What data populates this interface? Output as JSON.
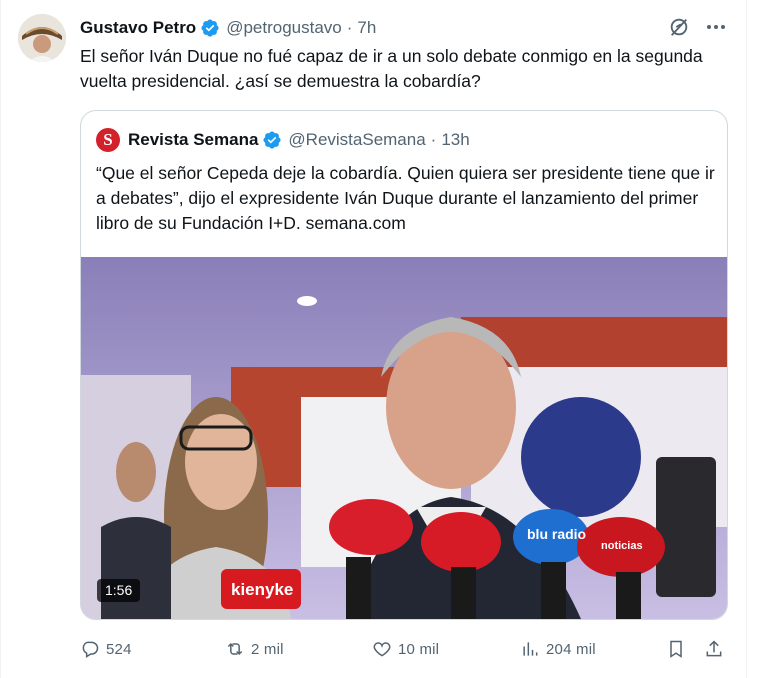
{
  "tweet": {
    "author_name": "Gustavo Petro",
    "handle": "@petrogustavo",
    "separator": "·",
    "time": "7h",
    "text": "El señor Iván Duque no fué capaz de ir a un solo debate conmigo en la segunda vuelta presidencial. ¿así se demuestra la cobardía?"
  },
  "quote": {
    "avatar_letter": "S",
    "author_name": "Revista Semana",
    "handle": "@RevistaSemana",
    "separator": "·",
    "time": "13h",
    "text": "“Que el señor Cepeda deje la cobardía. Quien quiera ser presidente tiene que ir a debates”, dijo el expresidente Iván Duque durante el lanzamiento del primer libro de su Fundación I+D.  semana.com",
    "video": {
      "duration": "1:56",
      "mic_labels": [
        "kienyke",
        "blu radio",
        "noticias"
      ]
    }
  },
  "actions": {
    "replies": "524",
    "reposts": "2 mil",
    "likes": "10 mil",
    "views": "204 mil"
  },
  "icons": {
    "verified": "verified-badge-icon",
    "grok": "grok-icon",
    "more": "more-icon",
    "reply": "reply-icon",
    "repost": "repost-icon",
    "like": "like-icon",
    "views": "views-icon",
    "bookmark": "bookmark-icon",
    "share": "share-icon"
  },
  "colors": {
    "accent": "#1d9bf0",
    "muted": "#536471",
    "semana_red": "#d4202a"
  }
}
